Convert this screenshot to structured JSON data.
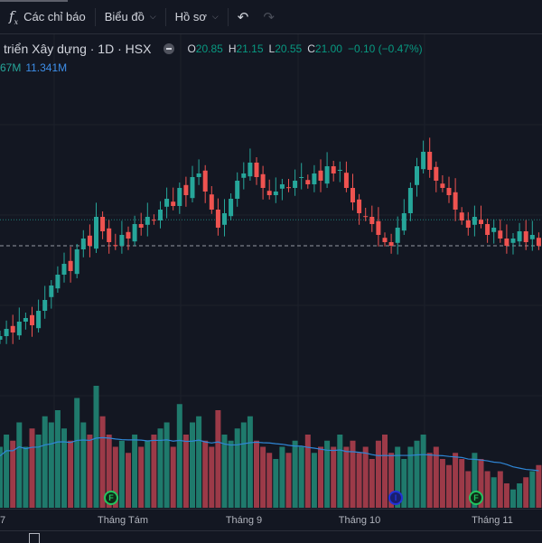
{
  "toolbar": {
    "indicators_label": "Các chỉ báo",
    "chart_label": "Biểu đồ",
    "profile_label": "Hồ sơ"
  },
  "legend": {
    "title": "triển Xây dựng · 1D · HSX",
    "o_label": "O",
    "o": "20.85",
    "h_label": "H",
    "h": "21.15",
    "l_label": "L",
    "l": "20.55",
    "c_label": "C",
    "c": "21.00",
    "change": "−0.10 (−0.47%)",
    "vol_a": "67M",
    "vol_b": "11.341M"
  },
  "xaxis": {
    "labels": [
      "7",
      "Tháng Tám",
      "Tháng 9",
      "Tháng 10",
      "Tháng 11"
    ]
  },
  "markers": [
    {
      "letter": "F",
      "color": "#22c55e"
    },
    {
      "letter": "I",
      "color": "#2232d8"
    },
    {
      "letter": "F",
      "color": "#22c55e"
    }
  ],
  "colors": {
    "up": "#26a69a",
    "down": "#ef5350",
    "vol_up": "#1f7a6c",
    "vol_down": "#9c3a48",
    "ma": "#2f86d6"
  },
  "chart_data": {
    "type": "candlestick",
    "last_price": 21.0,
    "close": [
      18.5,
      18.7,
      18.6,
      18.9,
      19.0,
      18.8,
      19.2,
      19.5,
      19.9,
      20.2,
      20.5,
      20.3,
      20.9,
      21.2,
      21.0,
      21.8,
      21.4,
      21.1,
      21.0,
      21.3,
      21.2,
      21.6,
      21.5,
      21.8,
      21.7,
      22.0,
      22.3,
      22.1,
      22.6,
      22.4,
      22.9,
      23.0,
      22.5,
      22.0,
      21.5,
      21.9,
      22.3,
      22.8,
      23.0,
      23.3,
      22.9,
      22.6,
      22.4,
      22.5,
      22.7,
      22.6,
      22.8,
      22.9,
      22.7,
      23.0,
      22.8,
      23.2,
      23.0,
      23.1,
      22.6,
      22.2,
      21.9,
      21.8,
      21.6,
      21.3,
      21.1,
      21.0,
      21.5,
      21.9,
      22.6,
      23.2,
      23.6,
      23.1,
      22.8,
      22.6,
      22.4,
      22.0,
      21.7,
      21.5,
      21.8,
      21.6,
      21.3,
      21.5,
      21.2,
      21.0,
      21.2,
      21.4,
      21.1,
      21.3,
      21.0
    ],
    "volume": [
      0.5,
      0.6,
      0.55,
      0.7,
      0.5,
      0.65,
      0.6,
      0.75,
      0.7,
      0.8,
      0.65,
      0.55,
      0.9,
      0.7,
      0.6,
      1.0,
      0.75,
      0.6,
      0.5,
      0.55,
      0.45,
      0.6,
      0.5,
      0.55,
      0.6,
      0.65,
      0.7,
      0.5,
      0.85,
      0.6,
      0.7,
      0.75,
      0.55,
      0.5,
      0.8,
      0.6,
      0.55,
      0.65,
      0.7,
      0.75,
      0.55,
      0.5,
      0.45,
      0.4,
      0.5,
      0.45,
      0.55,
      0.5,
      0.6,
      0.45,
      0.5,
      0.55,
      0.5,
      0.6,
      0.5,
      0.55,
      0.45,
      0.5,
      0.4,
      0.55,
      0.6,
      0.45,
      0.5,
      0.4,
      0.5,
      0.55,
      0.6,
      0.45,
      0.5,
      0.4,
      0.35,
      0.45,
      0.4,
      0.3,
      0.45,
      0.4,
      0.3,
      0.25,
      0.3,
      0.2,
      0.15,
      0.2,
      0.25,
      0.3,
      0.35
    ]
  }
}
